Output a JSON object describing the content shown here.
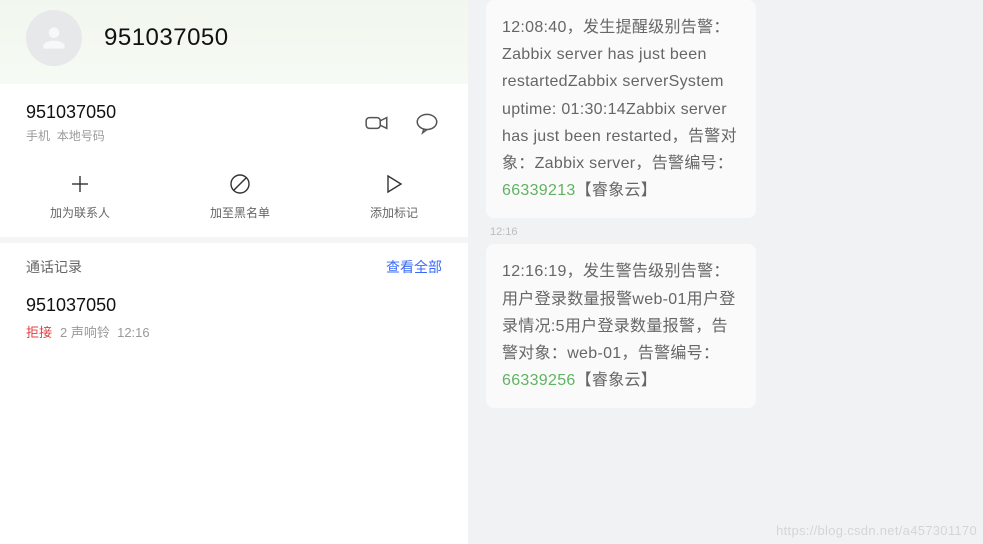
{
  "contact": {
    "name": "951037050",
    "number": "951037050",
    "type": "手机",
    "location": "本地号码"
  },
  "actions": {
    "add_contact": "加为联系人",
    "block": "加至黑名单",
    "add_tag": "添加标记"
  },
  "call_log": {
    "title": "通话记录",
    "view_all": "查看全部",
    "item": {
      "number": "951037050",
      "status": "拒接",
      "rings": "2 声响铃",
      "time": "12:16"
    }
  },
  "messages": {
    "ts1": "12:16",
    "msg1_text": "12:08:40，发生提醒级别告警：Zabbix server has just been restartedZabbix serverSystem uptime: 01:30:14Zabbix server has just been restarted，告警对象：Zabbix server，告警编号：",
    "msg1_code": "66339213",
    "msg1_suffix": "【睿象云】",
    "msg2_text": "12:16:19，发生警告级别告警：用户登录数量报警web-01用户登录情况:5用户登录数量报警，告警对象：web-01，告警编号：",
    "msg2_code": "66339256",
    "msg2_suffix": "【睿象云】"
  },
  "watermark": "https://blog.csdn.net/a457301170"
}
